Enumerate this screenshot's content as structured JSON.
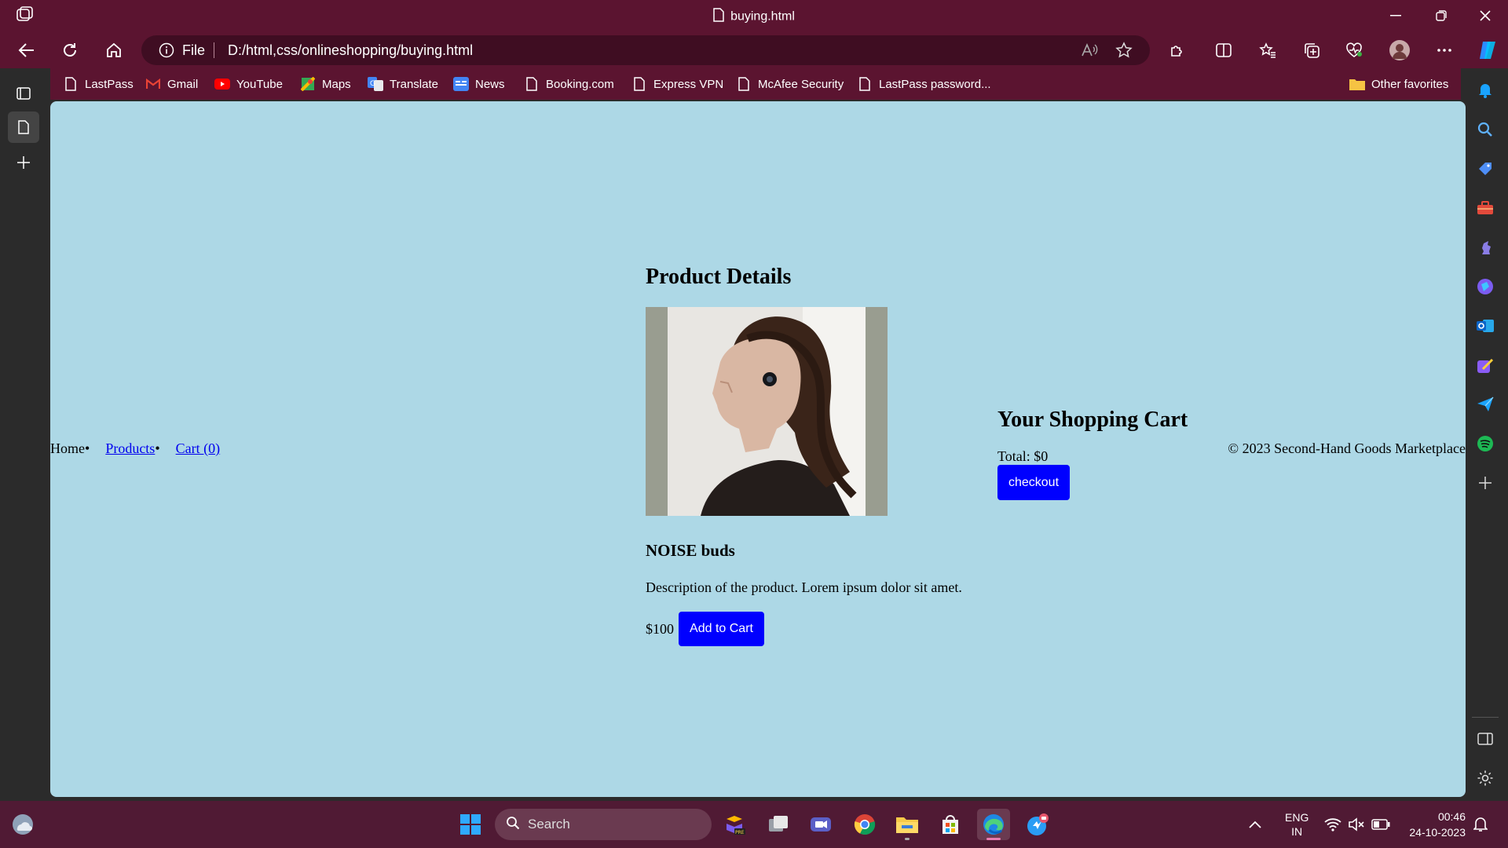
{
  "browser": {
    "tab_title": "buying.html",
    "address": {
      "scheme": "File",
      "url": "D:/html,css/onlineshopping/buying.html"
    },
    "favorites": [
      {
        "label": "LastPass",
        "icon": "page-icon"
      },
      {
        "label": "Gmail",
        "icon": "gmail-icon"
      },
      {
        "label": "YouTube",
        "icon": "youtube-icon"
      },
      {
        "label": "Maps",
        "icon": "maps-icon"
      },
      {
        "label": "Translate",
        "icon": "translate-icon"
      },
      {
        "label": "News",
        "icon": "news-icon"
      },
      {
        "label": "Booking.com",
        "icon": "page-icon"
      },
      {
        "label": "Express VPN",
        "icon": "page-icon"
      },
      {
        "label": "McAfee Security",
        "icon": "page-icon"
      },
      {
        "label": "LastPass password...",
        "icon": "page-icon"
      }
    ],
    "other_favorites": "Other favorites"
  },
  "page": {
    "nav": {
      "home": "Home",
      "products": "Products",
      "cart": "Cart (0)"
    },
    "product": {
      "heading": "Product Details",
      "name": "NOISE buds",
      "description": "Description of the product. Lorem ipsum dolor sit amet.",
      "price": "$100",
      "add_to_cart": "Add to Cart"
    },
    "cart": {
      "heading": "Your Shopping Cart",
      "total": "Total: $0",
      "checkout": "checkout"
    },
    "footer": "© 2023 Second-Hand Goods Marketplace"
  },
  "taskbar": {
    "search_placeholder": "Search",
    "language": {
      "lang": "ENG",
      "region": "IN"
    },
    "clock": {
      "time": "00:46",
      "date": "24-10-2023"
    }
  },
  "colors": {
    "titlebar": "#5b1430",
    "page_bg": "#add8e6",
    "button_blue": "#0000ff",
    "taskbar": "#501a34"
  }
}
